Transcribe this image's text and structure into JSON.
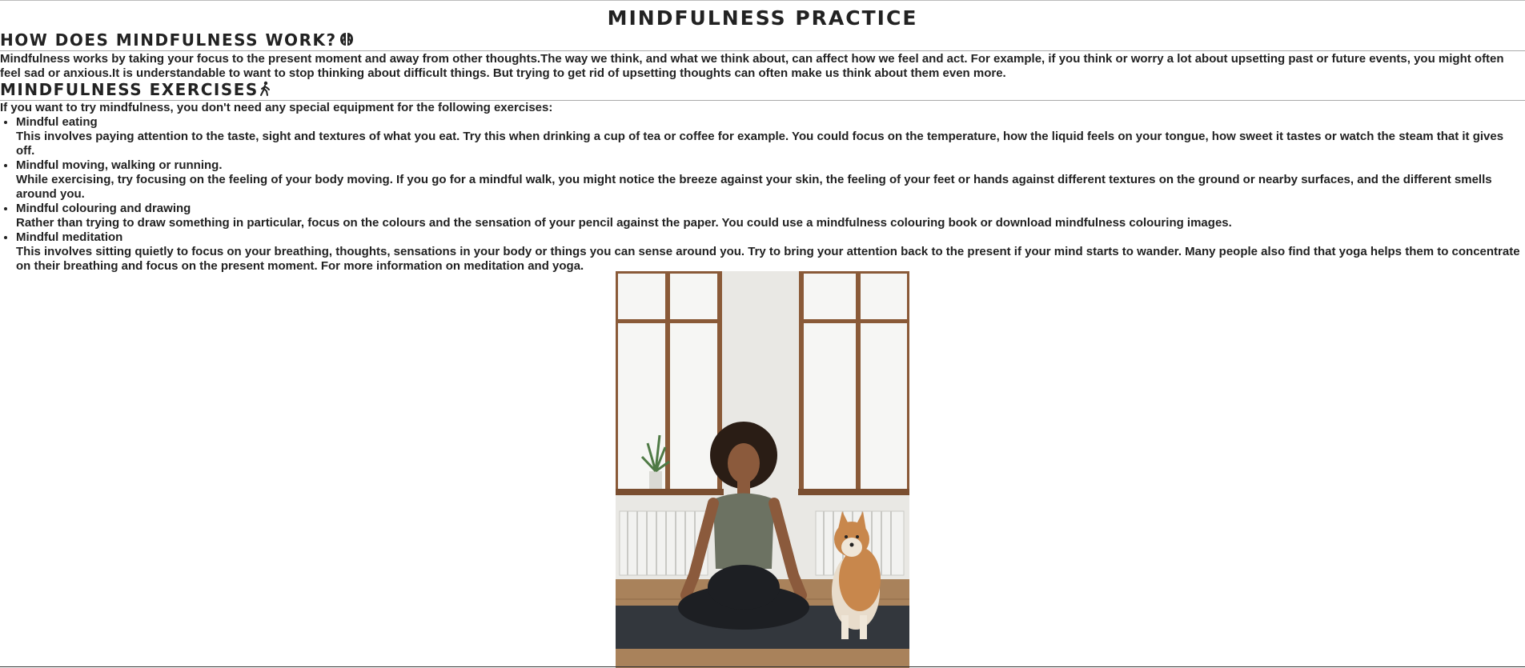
{
  "page": {
    "title": "MINDFULNESS PRACTICE"
  },
  "how": {
    "heading": "HOW DOES MINDFULNESS WORK?",
    "heading_icon": "brain-icon",
    "paragraph": "Mindfulness works by taking your focus to the present moment and away from other thoughts.The way we think, and what we think about, can affect how we feel and act. For example, if you think or worry a lot about upsetting past or future events, you might often feel sad or anxious.It is understandable to want to stop thinking about difficult things. But trying to get rid of upsetting thoughts can often make us think about them even more."
  },
  "exercises": {
    "heading": "MINDFULNESS EXERCISES",
    "heading_icon": "person-walking-icon",
    "intro": "If you want to try mindfulness, you don't need any special equipment for the following exercises:",
    "items": [
      {
        "title": "Mindful eating",
        "body": "This involves paying attention to the taste, sight and textures of what you eat. Try this when drinking a cup of tea or coffee for example. You could focus on the temperature, how the liquid feels on your tongue, how sweet it tastes or watch the steam that it gives off."
      },
      {
        "title": "Mindful moving, walking or running.",
        "body": "While exercising, try focusing on the feeling of your body moving. If you go for a mindful walk, you might notice the breeze against your skin, the feeling of your feet or hands against different textures on the ground or nearby surfaces, and the different smells around you."
      },
      {
        "title": "Mindful colouring and drawing",
        "body": "Rather than trying to draw something in particular, focus on the colours and the sensation of your pencil against the paper. You could use a mindfulness colouring book or download mindfulness colouring images."
      },
      {
        "title": "Mindful meditation",
        "body": "This involves sitting quietly to focus on your breathing, thoughts, sensations in your body or things you can sense around you. Try to bring your attention back to the present if your mind starts to wander. Many people also find that yoga helps them to concentrate on their breathing and focus on the present moment. For more information on meditation and yoga."
      }
    ]
  },
  "photo": {
    "icon": "meditation-photo"
  }
}
